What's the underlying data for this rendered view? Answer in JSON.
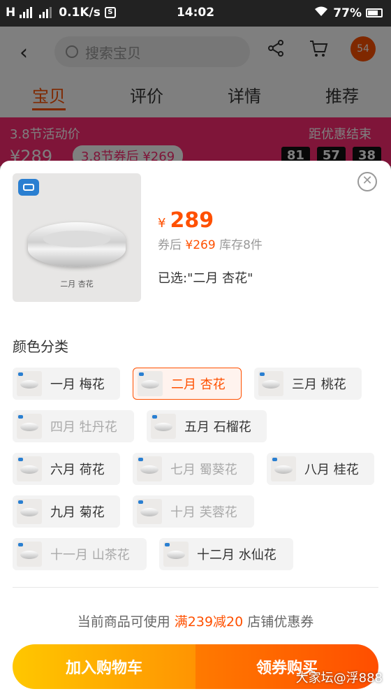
{
  "status_bar": {
    "network": "H",
    "speed": "0.1K/s",
    "sim_icon": "S",
    "time": "14:02",
    "battery": "77%"
  },
  "header": {
    "search_placeholder": "搜索宝贝",
    "cart_badge": "54",
    "tabs": [
      "宝贝",
      "评价",
      "详情",
      "推荐"
    ]
  },
  "promo": {
    "title": "3.8节活动价",
    "price": "¥289",
    "coupon": "3.8节券后 ¥269",
    "countdown_label": "距优惠结束",
    "countdown": [
      "81",
      "57",
      "38"
    ]
  },
  "sheet": {
    "thumbnail_caption": "二月 杏花",
    "price_symbol": "¥",
    "price": "289",
    "after_coupon_label": "券后",
    "after_coupon_price": "¥269",
    "stock": "库存8件",
    "selected_text": "已选:\"二月 杏花\"",
    "section_title": "颜色分类",
    "options": [
      {
        "label": "一月 梅花",
        "state": "normal"
      },
      {
        "label": "二月 杏花",
        "state": "selected"
      },
      {
        "label": "三月 桃花",
        "state": "normal"
      },
      {
        "label": "四月 牡丹花",
        "state": "disabled"
      },
      {
        "label": "五月 石榴花",
        "state": "normal"
      },
      {
        "label": "六月 荷花",
        "state": "normal"
      },
      {
        "label": "七月 蜀葵花",
        "state": "disabled"
      },
      {
        "label": "八月 桂花",
        "state": "normal"
      },
      {
        "label": "九月 菊花",
        "state": "normal"
      },
      {
        "label": "十月 芙蓉花",
        "state": "disabled"
      },
      {
        "label": "十一月 山茶花",
        "state": "disabled"
      },
      {
        "label": "十二月 水仙花",
        "state": "normal"
      }
    ],
    "notice_prefix": "当前商品可使用",
    "notice_highlight": "满239减20",
    "notice_suffix": "店铺优惠券",
    "add_to_cart": "加入购物车",
    "buy_with_coupon": "领券购买"
  },
  "watermark": "大家坛@浮888",
  "colors": {
    "accent": "#ff5000",
    "promo": "#ff2b72"
  },
  "icons": [
    "back-icon",
    "search-icon",
    "share-icon",
    "cart-icon",
    "close-icon"
  ]
}
